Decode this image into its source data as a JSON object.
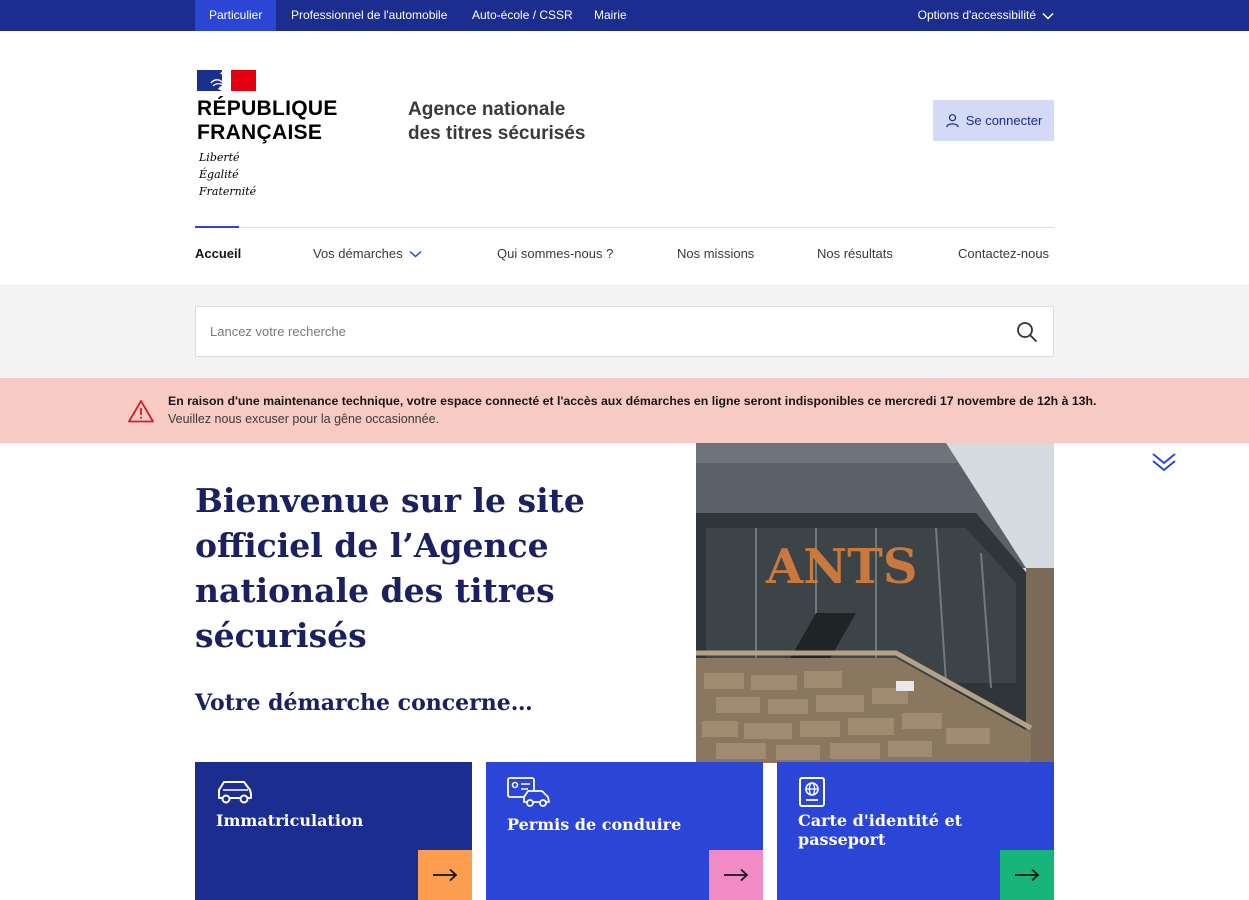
{
  "topbar": {
    "items": [
      "Particulier",
      "Professionnel de l'automobile",
      "Auto-école / CSSR",
      "Mairie"
    ],
    "accessibility": "Options d'accessibilité"
  },
  "header": {
    "republic_line1": "RÉPUBLIQUE",
    "republic_line2": "FRANÇAISE",
    "motto": [
      "Liberté",
      "Égalité",
      "Fraternité"
    ],
    "agency_line1": "Agence nationale",
    "agency_line2": "des titres sécurisés",
    "login_label": "Se connecter"
  },
  "nav": {
    "items": [
      "Accueil",
      "Vos démarches",
      "Qui sommes-nous ?",
      "Nos missions",
      "Nos résultats",
      "Contactez-nous"
    ]
  },
  "search": {
    "placeholder": "Lancez votre recherche"
  },
  "alert": {
    "line1": "En raison d'une maintenance technique, votre espace connecté et l'accès aux démarches en ligne seront indisponibles ce mercredi 17 novembre de 12h à 13h.",
    "line2": "Veuillez nous excuser pour la gêne occasionnée."
  },
  "hero": {
    "title": "Bienvenue sur le site officiel de l’Agence nationale des titres sécurisés",
    "subtitle": "Votre démarche concerne…",
    "photo_sign": "ANTS"
  },
  "cards": [
    {
      "label": "Immatriculation",
      "bg": "#1b2d8f",
      "arrow_bg": "#fc9d4f",
      "icon": "car-icon"
    },
    {
      "label": "Permis de conduire",
      "bg": "#2b46d6",
      "arrow_bg": "#f28bc5",
      "icon": "driving-license-icon"
    },
    {
      "label": "Carte d'identité et passeport",
      "bg": "#2b46d6",
      "arrow_bg": "#18b57a",
      "icon": "passport-icon"
    }
  ],
  "colors": {
    "primary": "#1b2d8f",
    "accent": "#2b46d6",
    "alert_bg": "#f8cac4",
    "alert_icon": "#ce1f2e"
  }
}
